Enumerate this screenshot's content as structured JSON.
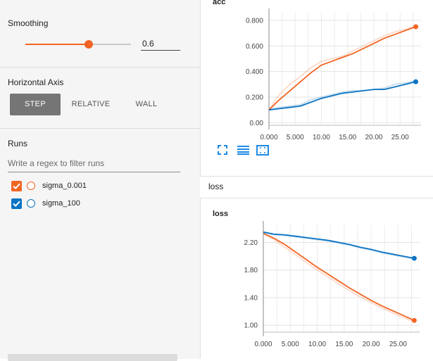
{
  "sidebar": {
    "smoothing": {
      "title": "Smoothing",
      "value": "0.6",
      "level": 0.6
    },
    "horizontal_axis": {
      "title": "Horizontal Axis",
      "options": [
        "STEP",
        "RELATIVE",
        "WALL"
      ],
      "selected": "STEP"
    },
    "runs": {
      "title": "Runs",
      "filter_placeholder": "Write a regex to filter runs",
      "items": [
        {
          "label": "sigma_0.001",
          "checked": true,
          "color": "#f26522"
        },
        {
          "label": "sigma_100",
          "checked": true,
          "color": "#0b74c4"
        }
      ]
    }
  },
  "main": {
    "group_label": "loss",
    "tools": [
      "fullscreen-icon",
      "toggle-log-icon",
      "fit-domain-icon"
    ]
  },
  "chart_data": [
    {
      "type": "line",
      "title": "acc",
      "xlabel": "",
      "ylabel": "",
      "xlim": [
        0,
        29
      ],
      "ylim": [
        -0.02,
        0.86
      ],
      "x_ticks": [
        "0.000",
        "5.000",
        "10.00",
        "15.00",
        "20.00",
        "25.00"
      ],
      "y_ticks": [
        "0.00",
        "0.200",
        "0.400",
        "0.600",
        "0.800"
      ],
      "grid": true,
      "series": [
        {
          "name": "sigma_0.001",
          "color": "#f26522",
          "x": [
            0,
            2,
            4,
            6,
            8,
            10,
            12,
            14,
            16,
            18,
            20,
            22,
            24,
            26,
            28
          ],
          "y": [
            0.1,
            0.18,
            0.25,
            0.32,
            0.39,
            0.45,
            0.48,
            0.51,
            0.54,
            0.58,
            0.62,
            0.66,
            0.69,
            0.72,
            0.75
          ],
          "raw_y": [
            0.1,
            0.22,
            0.3,
            0.36,
            0.43,
            0.48,
            0.5,
            0.52,
            0.56,
            0.6,
            0.64,
            0.68,
            0.71,
            0.73,
            0.76
          ]
        },
        {
          "name": "sigma_100",
          "color": "#0b74c4",
          "x": [
            0,
            2,
            4,
            6,
            8,
            10,
            12,
            14,
            16,
            18,
            20,
            22,
            24,
            26,
            28
          ],
          "y": [
            0.1,
            0.11,
            0.12,
            0.13,
            0.16,
            0.19,
            0.21,
            0.23,
            0.24,
            0.25,
            0.26,
            0.26,
            0.28,
            0.3,
            0.32
          ],
          "raw_y": [
            0.1,
            0.12,
            0.13,
            0.14,
            0.18,
            0.2,
            0.22,
            0.24,
            0.25,
            0.25,
            0.26,
            0.27,
            0.3,
            0.31,
            0.33
          ]
        }
      ]
    },
    {
      "type": "line",
      "title": "loss",
      "xlabel": "",
      "ylabel": "",
      "xlim": [
        0,
        29
      ],
      "ylim": [
        0.9,
        2.45
      ],
      "x_ticks": [
        "0.000",
        "5.000",
        "10.00",
        "15.00",
        "20.00",
        "25.00"
      ],
      "y_ticks": [
        "1.00",
        "1.40",
        "1.80",
        "2.20"
      ],
      "grid": true,
      "series": [
        {
          "name": "sigma_0.001",
          "color": "#f26522",
          "x": [
            0,
            2,
            4,
            6,
            8,
            10,
            12,
            14,
            16,
            18,
            20,
            22,
            24,
            26,
            28
          ],
          "y": [
            2.33,
            2.26,
            2.17,
            2.06,
            1.95,
            1.84,
            1.74,
            1.64,
            1.54,
            1.45,
            1.36,
            1.28,
            1.21,
            1.14,
            1.07
          ],
          "raw_y": [
            2.33,
            2.24,
            2.13,
            2.02,
            1.91,
            1.8,
            1.7,
            1.6,
            1.5,
            1.41,
            1.33,
            1.25,
            1.18,
            1.11,
            1.05
          ]
        },
        {
          "name": "sigma_100",
          "color": "#0b74c4",
          "x": [
            0,
            2,
            4,
            6,
            8,
            10,
            12,
            14,
            16,
            18,
            20,
            22,
            24,
            26,
            28
          ],
          "y": [
            2.35,
            2.32,
            2.31,
            2.29,
            2.27,
            2.25,
            2.23,
            2.2,
            2.17,
            2.13,
            2.1,
            2.06,
            2.03,
            2.0,
            1.97
          ],
          "raw_y": [
            2.34,
            2.31,
            2.3,
            2.28,
            2.26,
            2.24,
            2.22,
            2.19,
            2.16,
            2.12,
            2.09,
            2.05,
            2.02,
            1.99,
            1.96
          ]
        }
      ]
    }
  ]
}
